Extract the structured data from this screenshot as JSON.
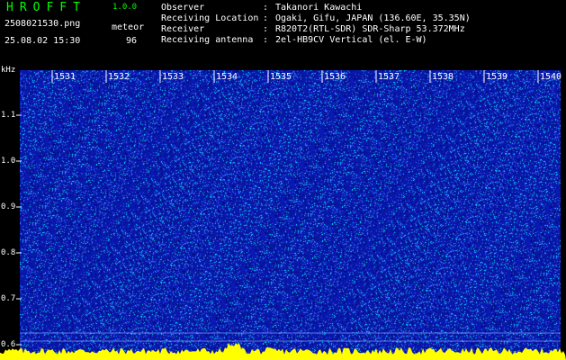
{
  "header": {
    "app_name": "HROFFT",
    "version": "1.0.0",
    "filename": "2508021530.png",
    "timestamp": "25.08.02 15:30",
    "meteor_label": "meteor",
    "meteor_count": "96"
  },
  "info": [
    {
      "label": "Observer",
      "value": "Takanori Kawachi"
    },
    {
      "label": "Receiving Location",
      "value": "Ogaki, Gifu, JAPAN (136.60E, 35.35N)"
    },
    {
      "label": "Receiver",
      "value": "R820T2(RTL-SDR) SDR-Sharp 53.372MHz"
    },
    {
      "label": "Receiving antenna",
      "value": "2el-HB9CV Vertical (el. E-W)"
    }
  ],
  "info_separator": ":",
  "plot": {
    "y_unit": "kHz",
    "y_ticks": [
      "1.1",
      "1.0",
      "0.9",
      "0.8",
      "0.7",
      "0.6"
    ],
    "y_tick_values": [
      1.1,
      1.0,
      0.9,
      0.8,
      0.7,
      0.6
    ],
    "x_ticks": [
      "1531",
      "1532",
      "1533",
      "1534",
      "1535",
      "1536",
      "1537",
      "1538",
      "1539",
      "1540"
    ],
    "colors": {
      "background": "#000000",
      "spectrogram_base": "#0a1ab8",
      "noise_cyan": "#00ffff",
      "noise_light": "#3c78ff",
      "baseline_yellow": "#ffff00",
      "text": "#ffffff",
      "title_green": "#00ff00"
    }
  }
}
